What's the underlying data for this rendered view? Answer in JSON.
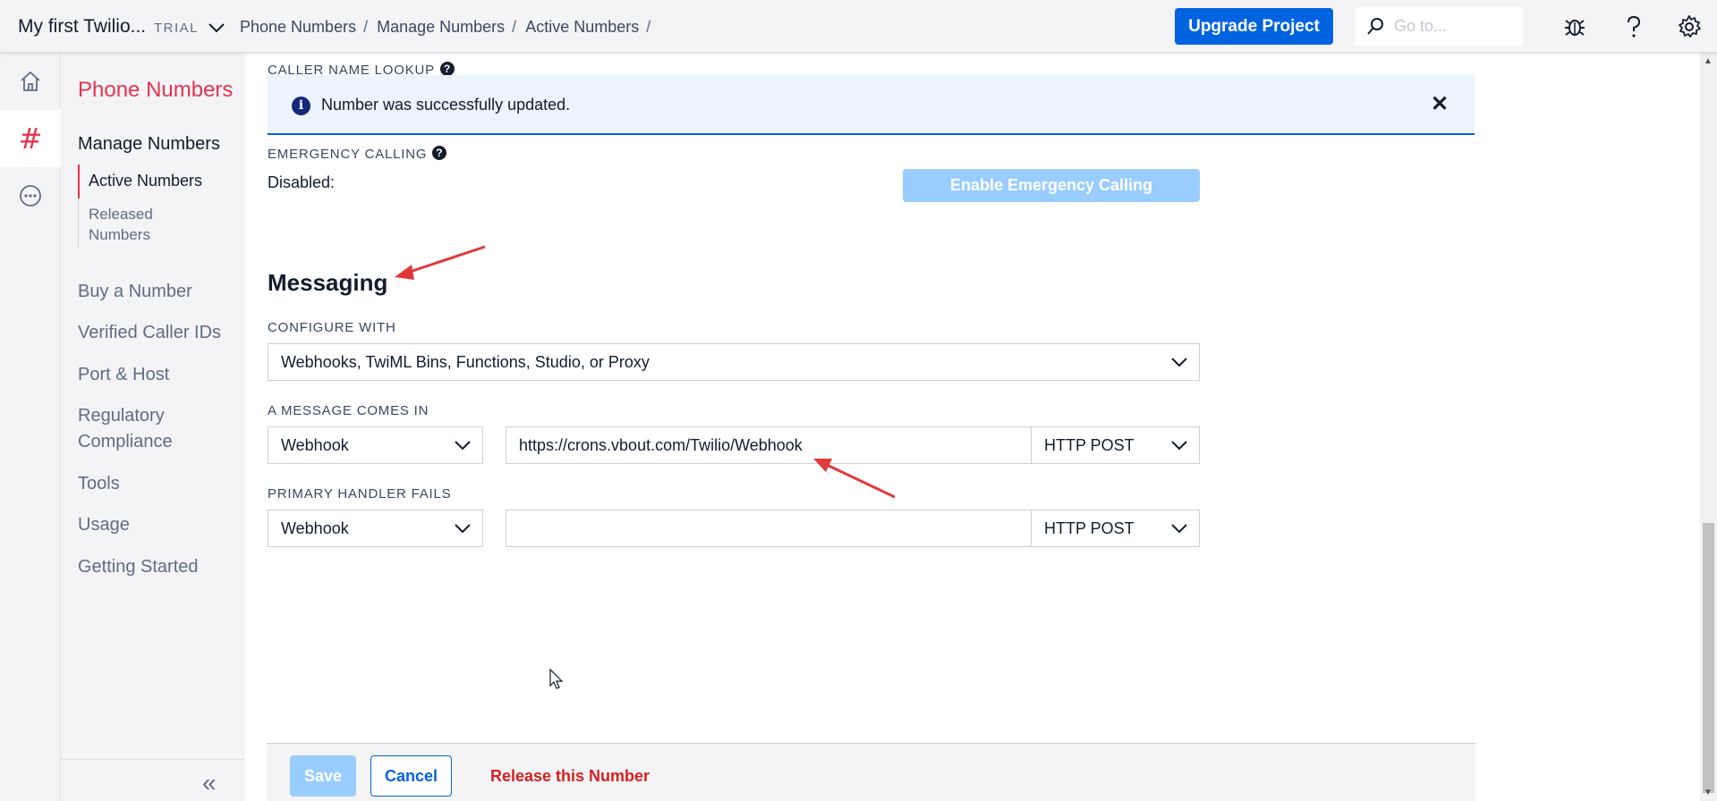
{
  "header": {
    "project_name": "My first Twilio...",
    "plan_badge": "TRIAL",
    "breadcrumbs": [
      "Phone Numbers",
      "Manage Numbers",
      "Active Numbers"
    ],
    "breadcrumb_separator": "/",
    "upgrade_label": "Upgrade Project",
    "search_placeholder": "Go to...",
    "icons": [
      "chevron-down-icon",
      "search-icon",
      "bug-icon",
      "help-icon",
      "settings-gear-icon"
    ]
  },
  "rail": {
    "items": [
      "home-icon",
      "hash-icon",
      "more-icon"
    ],
    "hash_glyph": "#"
  },
  "sidebar": {
    "title": "Phone Numbers",
    "section": "Manage Numbers",
    "active_item": "Active Numbers",
    "released_item": "Released Numbers",
    "items": [
      "Buy a Number",
      "Verified Caller IDs",
      "Port & Host",
      "Regulatory Compliance",
      "Tools",
      "Usage",
      "Getting Started"
    ],
    "collapse_glyph": "«"
  },
  "main": {
    "caller_name_label": "CALLER NAME LOOKUP",
    "banner": {
      "info_glyph": "i",
      "message": "Number was successfully updated.",
      "close_glyph": "✕"
    },
    "emergency": {
      "label": "EMERGENCY CALLING",
      "status": "Disabled:",
      "button_label": "Enable Emergency Calling"
    },
    "messaging": {
      "heading": "Messaging",
      "configure_label": "CONFIGURE WITH",
      "configure_value": "Webhooks, TwiML Bins, Functions, Studio, or Proxy",
      "message_in_label": "A MESSAGE COMES IN",
      "message_in_type": "Webhook",
      "message_in_url": "https://crons.vbout.com/Twilio/Webhook",
      "message_in_method": "HTTP POST",
      "fallback_label": "PRIMARY HANDLER FAILS",
      "fallback_type": "Webhook",
      "fallback_url": "",
      "fallback_method": "HTTP POST"
    },
    "help_glyph": "?"
  },
  "footer": {
    "save_label": "Save",
    "cancel_label": "Cancel",
    "release_label": "Release this Number"
  },
  "colors": {
    "brand_red": "#e4344e",
    "primary_blue": "#0263e0",
    "disabled_blue": "#99cdff",
    "banner_bg": "#ebf4ff",
    "danger_red": "#d61f1f",
    "annotation_arrow": "#e03a3a"
  }
}
